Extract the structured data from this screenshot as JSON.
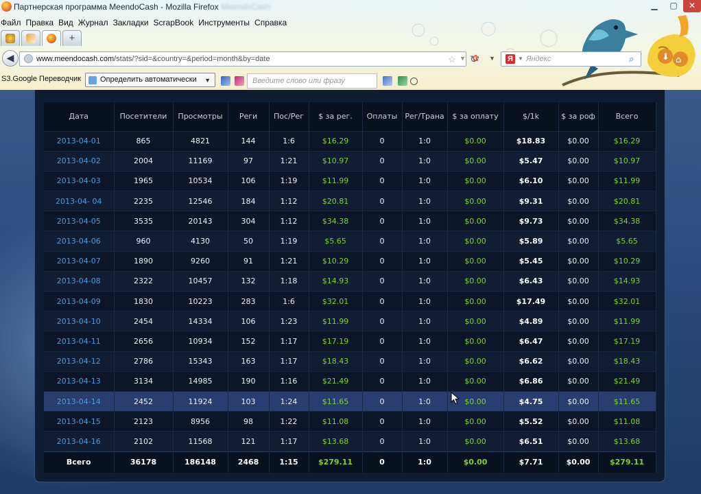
{
  "window": {
    "title": "Партнерская программа MeendoCash - Mozilla Firefox",
    "title_blur": "MeendoCash"
  },
  "menu": [
    "Файл",
    "Правка",
    "Вид",
    "Журнал",
    "Закладки",
    "ScrapBook",
    "Инструменты",
    "Справка"
  ],
  "navbar": {
    "url_host": "www.meendocash.com",
    "url_path": "/stats/?sid=&country=&period=month&by=date",
    "search_placeholder": "Яндекс",
    "search_engine_letter": "Я"
  },
  "translator": {
    "label": "S3.Google Переводчик",
    "language": "Определить автоматически",
    "placeholder": "Введите слово или фразу"
  },
  "table": {
    "headers": [
      "Дата",
      "Посетители",
      "Просмотры",
      "Реги",
      "Пос/Рег",
      "$ за рег.",
      "Оплаты",
      "Рег/Трана",
      "$ за оплату",
      "$/1k",
      "$ за роф",
      "Всего"
    ],
    "rows": [
      [
        "2013-04-01",
        "865",
        "4821",
        "144",
        "1:6",
        "$16.29",
        "0",
        "1:0",
        "$0.00",
        "$18.83",
        "$0.00",
        "$16.29"
      ],
      [
        "2013-04-02",
        "2004",
        "11169",
        "97",
        "1:21",
        "$10.97",
        "0",
        "1:0",
        "$0.00",
        "$5.47",
        "$0.00",
        "$10.97"
      ],
      [
        "2013-04-03",
        "1965",
        "10534",
        "106",
        "1:19",
        "$11.99",
        "0",
        "1:0",
        "$0.00",
        "$6.10",
        "$0.00",
        "$11.99"
      ],
      [
        "2013-04- 04",
        "2235",
        "12546",
        "184",
        "1:12",
        "$20.81",
        "0",
        "1:0",
        "$0.00",
        "$9.31",
        "$0.00",
        "$20.81"
      ],
      [
        "2013-04-05",
        "3535",
        "20143",
        "304",
        "1:12",
        "$34.38",
        "0",
        "1:0",
        "$0.00",
        "$9.73",
        "$0.00",
        "$34.38"
      ],
      [
        "2013-04-06",
        "960",
        "4130",
        "50",
        "1:19",
        "$5.65",
        "0",
        "1:0",
        "$0.00",
        "$5.89",
        "$0.00",
        "$5.65"
      ],
      [
        "2013-04-07",
        "1890",
        "9260",
        "91",
        "1:21",
        "$10.29",
        "0",
        "1:0",
        "$0.00",
        "$5.45",
        "$0.00",
        "$10.29"
      ],
      [
        "2013-04-08",
        "2322",
        "10457",
        "132",
        "1:18",
        "$14.93",
        "0",
        "1:0",
        "$0.00",
        "$6.43",
        "$0.00",
        "$14.93"
      ],
      [
        "2013-04-09",
        "1830",
        "10223",
        "283",
        "1:6",
        "$32.01",
        "0",
        "1:0",
        "$0.00",
        "$17.49",
        "$0.00",
        "$32.01"
      ],
      [
        "2013-04-10",
        "2454",
        "14334",
        "106",
        "1:23",
        "$11.99",
        "0",
        "1:0",
        "$0.00",
        "$4.89",
        "$0.00",
        "$11.99"
      ],
      [
        "2013-04-11",
        "2656",
        "10934",
        "152",
        "1:17",
        "$17.19",
        "0",
        "1:0",
        "$0.00",
        "$6.47",
        "$0.00",
        "$17.19"
      ],
      [
        "2013-04-12",
        "2786",
        "15343",
        "163",
        "1:17",
        "$18.43",
        "0",
        "1:0",
        "$0.00",
        "$6.62",
        "$0.00",
        "$18.43"
      ],
      [
        "2013-04-13",
        "3134",
        "14985",
        "190",
        "1:16",
        "$21.49",
        "0",
        "1:0",
        "$0.00",
        "$6.86",
        "$0.00",
        "$21.49"
      ],
      [
        "2013-04-14",
        "2452",
        "11924",
        "103",
        "1:24",
        "$11.65",
        "0",
        "1:0",
        "$0.00",
        "$4.75",
        "$0.00",
        "$11.65"
      ],
      [
        "2013-04-15",
        "2123",
        "8956",
        "98",
        "1:22",
        "$11.08",
        "0",
        "1:0",
        "$0.00",
        "$5.52",
        "$0.00",
        "$11.08"
      ],
      [
        "2013-04-16",
        "2102",
        "11568",
        "121",
        "1:17",
        "$13.68",
        "0",
        "1:0",
        "$0.00",
        "$6.51",
        "$0.00",
        "$13.68"
      ]
    ],
    "highlighted_row": 13,
    "totals": [
      "Всего",
      "36178",
      "186148",
      "2468",
      "1:15",
      "$279.11",
      "0",
      "1:0",
      "$0.00",
      "$7.71",
      "$0.00",
      "$279.11"
    ]
  },
  "colors": {
    "date_link": "#4f9ad8",
    "money_green": "#7ed52a",
    "highlight_row": "#2a3d70",
    "panel_bg": "#0f1d33"
  }
}
